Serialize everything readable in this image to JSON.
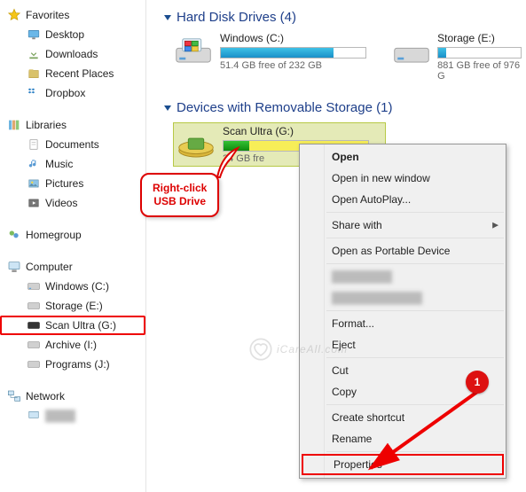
{
  "sidebar": {
    "favorites": {
      "label": "Favorites",
      "items": [
        "Desktop",
        "Downloads",
        "Recent Places",
        "Dropbox"
      ]
    },
    "libraries": {
      "label": "Libraries",
      "items": [
        "Documents",
        "Music",
        "Pictures",
        "Videos"
      ]
    },
    "homegroup": {
      "label": "Homegroup"
    },
    "computer": {
      "label": "Computer",
      "items": [
        "Windows (C:)",
        "Storage (E:)",
        "Scan Ultra (G:)",
        "Archive (I:)",
        "Programs (J:)"
      ]
    },
    "network": {
      "label": "Network"
    }
  },
  "main": {
    "hdd": {
      "title": "Hard Disk Drives (4)",
      "drives": [
        {
          "name": "Windows (C:)",
          "free": "51.4 GB free of 232 GB",
          "fill_pct": 78
        },
        {
          "name": "Storage (E:)",
          "free": "881 GB free of 976 G",
          "fill_pct": 10
        }
      ]
    },
    "removable": {
      "title": "Devices with Removable Storage (1)",
      "drive": {
        "name": "Scan Ultra (G:)",
        "free": "24   GB fre",
        "fill_pct": 18
      }
    }
  },
  "callout": {
    "line1": "Right-click",
    "line2": "USB Drive"
  },
  "menu": {
    "open": "Open",
    "open_new": "Open in new window",
    "autoplay": "Open AutoPlay...",
    "share": "Share with",
    "portable": "Open as Portable Device",
    "format": "Format...",
    "eject": "Eject",
    "cut": "Cut",
    "copy": "Copy",
    "shortcut": "Create shortcut",
    "rename": "Rename",
    "properties": "Properties"
  },
  "badge": "1",
  "watermark": "iCareAll.com"
}
